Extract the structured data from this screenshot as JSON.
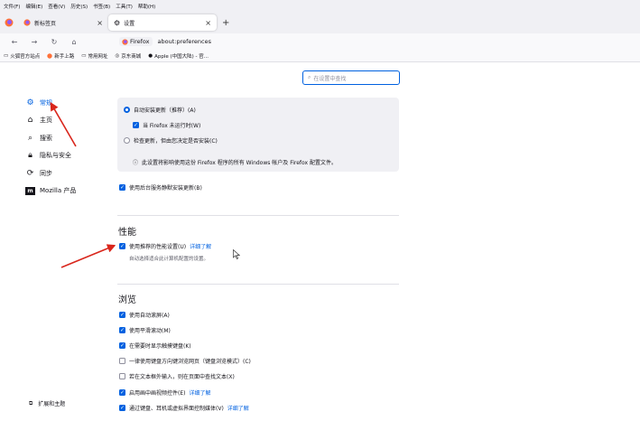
{
  "menubar": [
    "文件(F)",
    "编辑(E)",
    "查看(V)",
    "历史(S)",
    "书签(B)",
    "工具(T)",
    "帮助(H)"
  ],
  "tabs": [
    {
      "label": "新标签页",
      "active": false
    },
    {
      "label": "设置",
      "active": true
    }
  ],
  "new_tab_symbol": "+",
  "close_symbol": "×",
  "urlbar": {
    "identity": "Firefox",
    "url": "about:preferences"
  },
  "bookmarks": [
    "火狐官方站点",
    "新手上路",
    "常用网址",
    "京东商城",
    "Apple (中国大陆) - 官..."
  ],
  "search": {
    "placeholder": "在设置中查找"
  },
  "sidebar": {
    "items": [
      {
        "label": "常规",
        "icon": "gear-icon",
        "active": true
      },
      {
        "label": "主页",
        "icon": "home-icon",
        "active": false
      },
      {
        "label": "搜索",
        "icon": "search-icon",
        "active": false
      },
      {
        "label": "隐私与安全",
        "icon": "lock-icon",
        "active": false
      },
      {
        "label": "同步",
        "icon": "sync-icon",
        "active": false
      },
      {
        "label": "Mozilla 产品",
        "icon": "mozilla-icon",
        "active": false
      }
    ],
    "extensions": "扩展和主题"
  },
  "updates": {
    "auto_install": "自动安装更新（推荐）(A)",
    "when_not_running": "当 Firefox 未运行时(W)",
    "check_only": "检查更新，但由您决定是否安装(C)",
    "info": "此设置将影响使用这份 Firefox 程序的所有 Windows 帐户及 Firefox 配置文件。",
    "background_service": "使用后台服务静默安装更新(B)"
  },
  "performance": {
    "heading": "性能",
    "recommended": "使用推荐的性能设置(U)",
    "learn_more": "详细了解",
    "description": "自动选择适合此计算机配置的设置。"
  },
  "browsing": {
    "heading": "浏览",
    "items": [
      {
        "label": "使用自动滚屏(A)",
        "checked": true
      },
      {
        "label": "使用平滑滚动(M)",
        "checked": true
      },
      {
        "label": "在需要时显示触摸键盘(K)",
        "checked": true
      },
      {
        "label": "一律使用键盘方向键浏览网页（键盘浏览模式）(C)",
        "checked": false
      },
      {
        "label": "若在文本框外输入，则在页面中查找文本(X)",
        "checked": false
      },
      {
        "label": "启用画中画视频控件(E)",
        "checked": true,
        "link": "详细了解"
      },
      {
        "label": "通过键盘、耳机或虚拟界面控制媒体(V)",
        "checked": true,
        "link": "详细了解"
      }
    ]
  },
  "colors": {
    "accent": "#0061e0",
    "annotation_arrow": "#d9261c"
  }
}
